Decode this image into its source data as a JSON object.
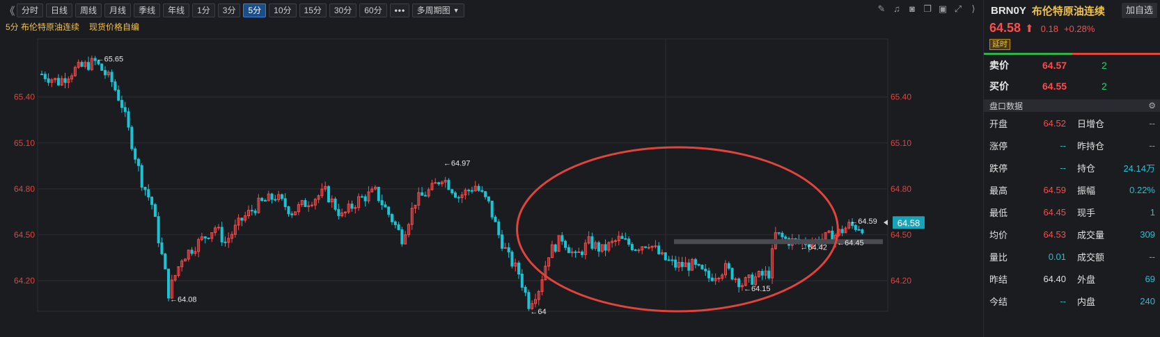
{
  "toolbar": {
    "collapse_glyph": "《",
    "periods": [
      "分时",
      "日线",
      "周线",
      "月线",
      "季线",
      "年线",
      "1分",
      "3分",
      "5分",
      "10分",
      "15分",
      "30分",
      "60分"
    ],
    "active_period": "5分",
    "more_glyph": "•••",
    "multi_period_label": "多周期图",
    "icons": [
      "pen-icon",
      "bell-icon",
      "camera-icon",
      "copy-icon",
      "layout-icon",
      "fullscreen-icon",
      "collapse-right-icon"
    ]
  },
  "subtitle": {
    "period_name": "5分 布伦特原油连续",
    "spot_price_label": "现货价格自编"
  },
  "chart_data": {
    "type": "candlestick",
    "interval": "5分",
    "ylim": [
      64.0,
      65.78
    ],
    "y_ticks": [
      65.4,
      65.1,
      64.8,
      64.5,
      64.2
    ],
    "y_tick_labels": [
      "65.40",
      "65.10",
      "64.80",
      "64.50",
      "64.20"
    ],
    "current_price_tag": "64.58",
    "current_price": 64.58,
    "annotations": [
      {
        "label": "65.65",
        "price": 65.65,
        "bar": 16
      },
      {
        "label": "64.08",
        "price": 64.08,
        "bar": 38
      },
      {
        "label": "64.97",
        "price": 64.97,
        "bar": 120
      },
      {
        "label": "64",
        "price": 64.0,
        "bar": 146
      },
      {
        "label": "64.15",
        "price": 64.15,
        "bar": 210
      },
      {
        "label": "64.42",
        "price": 64.42,
        "bar": 227
      },
      {
        "label": "64.45",
        "price": 64.45,
        "bar": 238
      },
      {
        "label": "64.59",
        "price": 64.59,
        "bar": 242
      }
    ],
    "highlight_ellipse": {
      "from_bar": 145,
      "to_bar": 232
    },
    "up_color": "#ff4b4b",
    "down_color": "#18c5d6",
    "grid": true
  },
  "panel": {
    "symbol_code": "BRN0Y",
    "symbol_name": "布伦特原油连续",
    "add_watch_label": "加自选",
    "last_price": "64.58",
    "change": "0.18",
    "change_pct": "+0.28%",
    "delay_label": "延时",
    "ask": {
      "label": "卖价",
      "price": "64.57",
      "volume": "2"
    },
    "bid": {
      "label": "买价",
      "price": "64.55",
      "volume": "2"
    },
    "section_title": "盘口数据",
    "stats": [
      {
        "l1": "开盘",
        "v1": "64.52",
        "c1": "red",
        "l2": "日增仓",
        "v2": "--",
        "c2": "gray"
      },
      {
        "l1": "涨停",
        "v1": "--",
        "c1": "cyan",
        "l2": "昨持仓",
        "v2": "--",
        "c2": "gray"
      },
      {
        "l1": "跌停",
        "v1": "--",
        "c1": "cyan",
        "l2": "持仓",
        "v2": "24.14万",
        "c2": "cyan"
      },
      {
        "l1": "最高",
        "v1": "64.59",
        "c1": "red",
        "l2": "振幅",
        "v2": "0.22%",
        "c2": "cyan"
      },
      {
        "l1": "最低",
        "v1": "64.45",
        "c1": "red",
        "l2": "现手",
        "v2": "1",
        "c2": "cyan"
      },
      {
        "l1": "均价",
        "v1": "64.53",
        "c1": "red",
        "l2": "成交量",
        "v2": "309",
        "c2": "cyan"
      },
      {
        "l1": "量比",
        "v1": "0.01",
        "c1": "cyan",
        "l2": "成交额",
        "v2": "--",
        "c2": "gray"
      },
      {
        "l1": "昨结",
        "v1": "64.40",
        "c1": "white",
        "l2": "外盘",
        "v2": "69",
        "c2": "cyan"
      },
      {
        "l1": "今结",
        "v1": "--",
        "c1": "cyan",
        "l2": "内盘",
        "v2": "240",
        "c2": "cyan"
      }
    ]
  }
}
